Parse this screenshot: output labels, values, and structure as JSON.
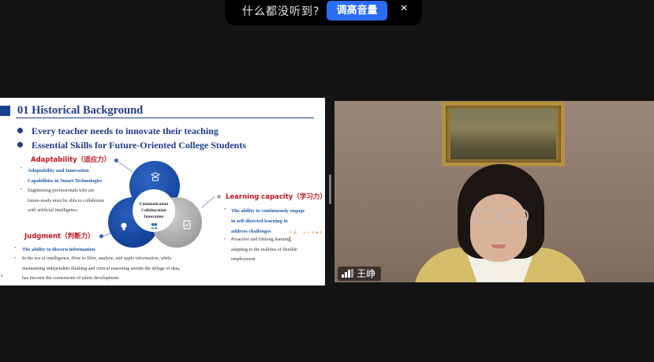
{
  "notification": {
    "message": "什么都没听到?",
    "button_label": "调高音量",
    "close_glyph": "×"
  },
  "slide": {
    "title": "01 Historical Background",
    "bullets": [
      "Every teacher needs to innovate their teaching",
      "Essential Skills for Future-Oriented College Students"
    ],
    "adaptability": {
      "heading": "Adaptability（适应力）",
      "sub": [
        "Adaptability and Innovation",
        "Capabilities in Smart Technologies"
      ],
      "body": [
        "Engineering professionals who are",
        "future-ready must be able to collaborate",
        "with artificial intelligence."
      ]
    },
    "learning": {
      "heading": "Learning capacity（学习力）",
      "sub": [
        "The ability to continuously engage",
        "in self-directed learning to",
        "address challenges"
      ],
      "body": [
        "Proactive and lifelong learning,",
        "adapting to the realities of flexible",
        "employment"
      ]
    },
    "judgment": {
      "heading": "Judgment（判断力）",
      "sub": "The ability to discern information",
      "body": [
        "In the era of intelligence, How to filter, analyze, and apply  information, while",
        "maintaining independent thinking and critical reasoning amidst the deluge of data,",
        "has become the cornerstone of talent development."
      ]
    },
    "venn_center": [
      "Communication",
      "Collaboration",
      "Innovation"
    ],
    "emoji_strip": "◎ 英 ·,· ♦ ☺ ⚙ ◙ ▦ ◈",
    "page_number": "4",
    "bullet_glyph": "•"
  },
  "video": {
    "participant_name": "王峥"
  },
  "colors": {
    "accent_blue": "#1f3c88",
    "heading_red": "#c0161e",
    "button_blue": "#2b6df2",
    "background": "#141414"
  }
}
